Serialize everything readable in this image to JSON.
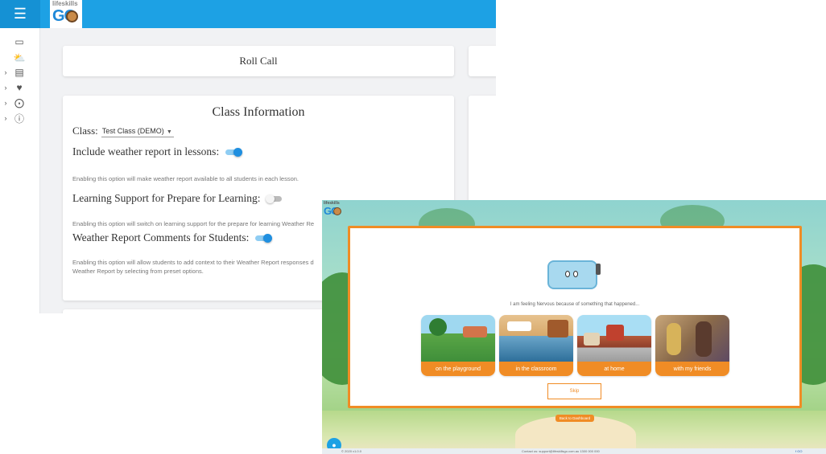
{
  "back_window": {
    "logo_small": "lifeskills",
    "logo_main": "GO",
    "nav_icons": [
      "laptop-icon",
      "weather-icon",
      "presentation-icon",
      "hand-heart-icon",
      "lifebuoy-icon",
      "help-icon"
    ],
    "roll_call": "Roll Call",
    "class_info": {
      "title": "Class Information",
      "class_label": "Class:",
      "class_value": "Test Class (DEMO)",
      "options": [
        {
          "label": "Include weather report in lessons:",
          "enabled": true,
          "description": "Enabling this option will make weather report available to all students in each lesson."
        },
        {
          "label": "Learning Support for Prepare for Learning:",
          "enabled": false,
          "description": "Enabling this option will switch on learning support for the prepare for learning Weather Re"
        },
        {
          "label": "Weather Report Comments for Students:",
          "enabled": true,
          "description": "Enabling this option will allow students to add context to their Weather Report responses d Weather Report by selecting from preset options."
        }
      ]
    }
  },
  "front_window": {
    "logo_small": "lifeskills",
    "logo_main": "GO",
    "feeling_text": "I am feeling Nervous because of something that happened...",
    "choices": [
      {
        "label": "on the playground"
      },
      {
        "label": "in the classroom"
      },
      {
        "label": "at home"
      },
      {
        "label": "with my friends"
      }
    ],
    "skip_label": "Skip",
    "back_to_dashboard": "Back to Dashboard",
    "footer": {
      "left": "© 2020 v1.0.0",
      "contact": "Contact us:  support@lifeskillsgo.com.au  1300 000 000",
      "right": "f GO"
    },
    "colors": {
      "accent": "#f08c25",
      "brand": "#1da1e4"
    }
  }
}
